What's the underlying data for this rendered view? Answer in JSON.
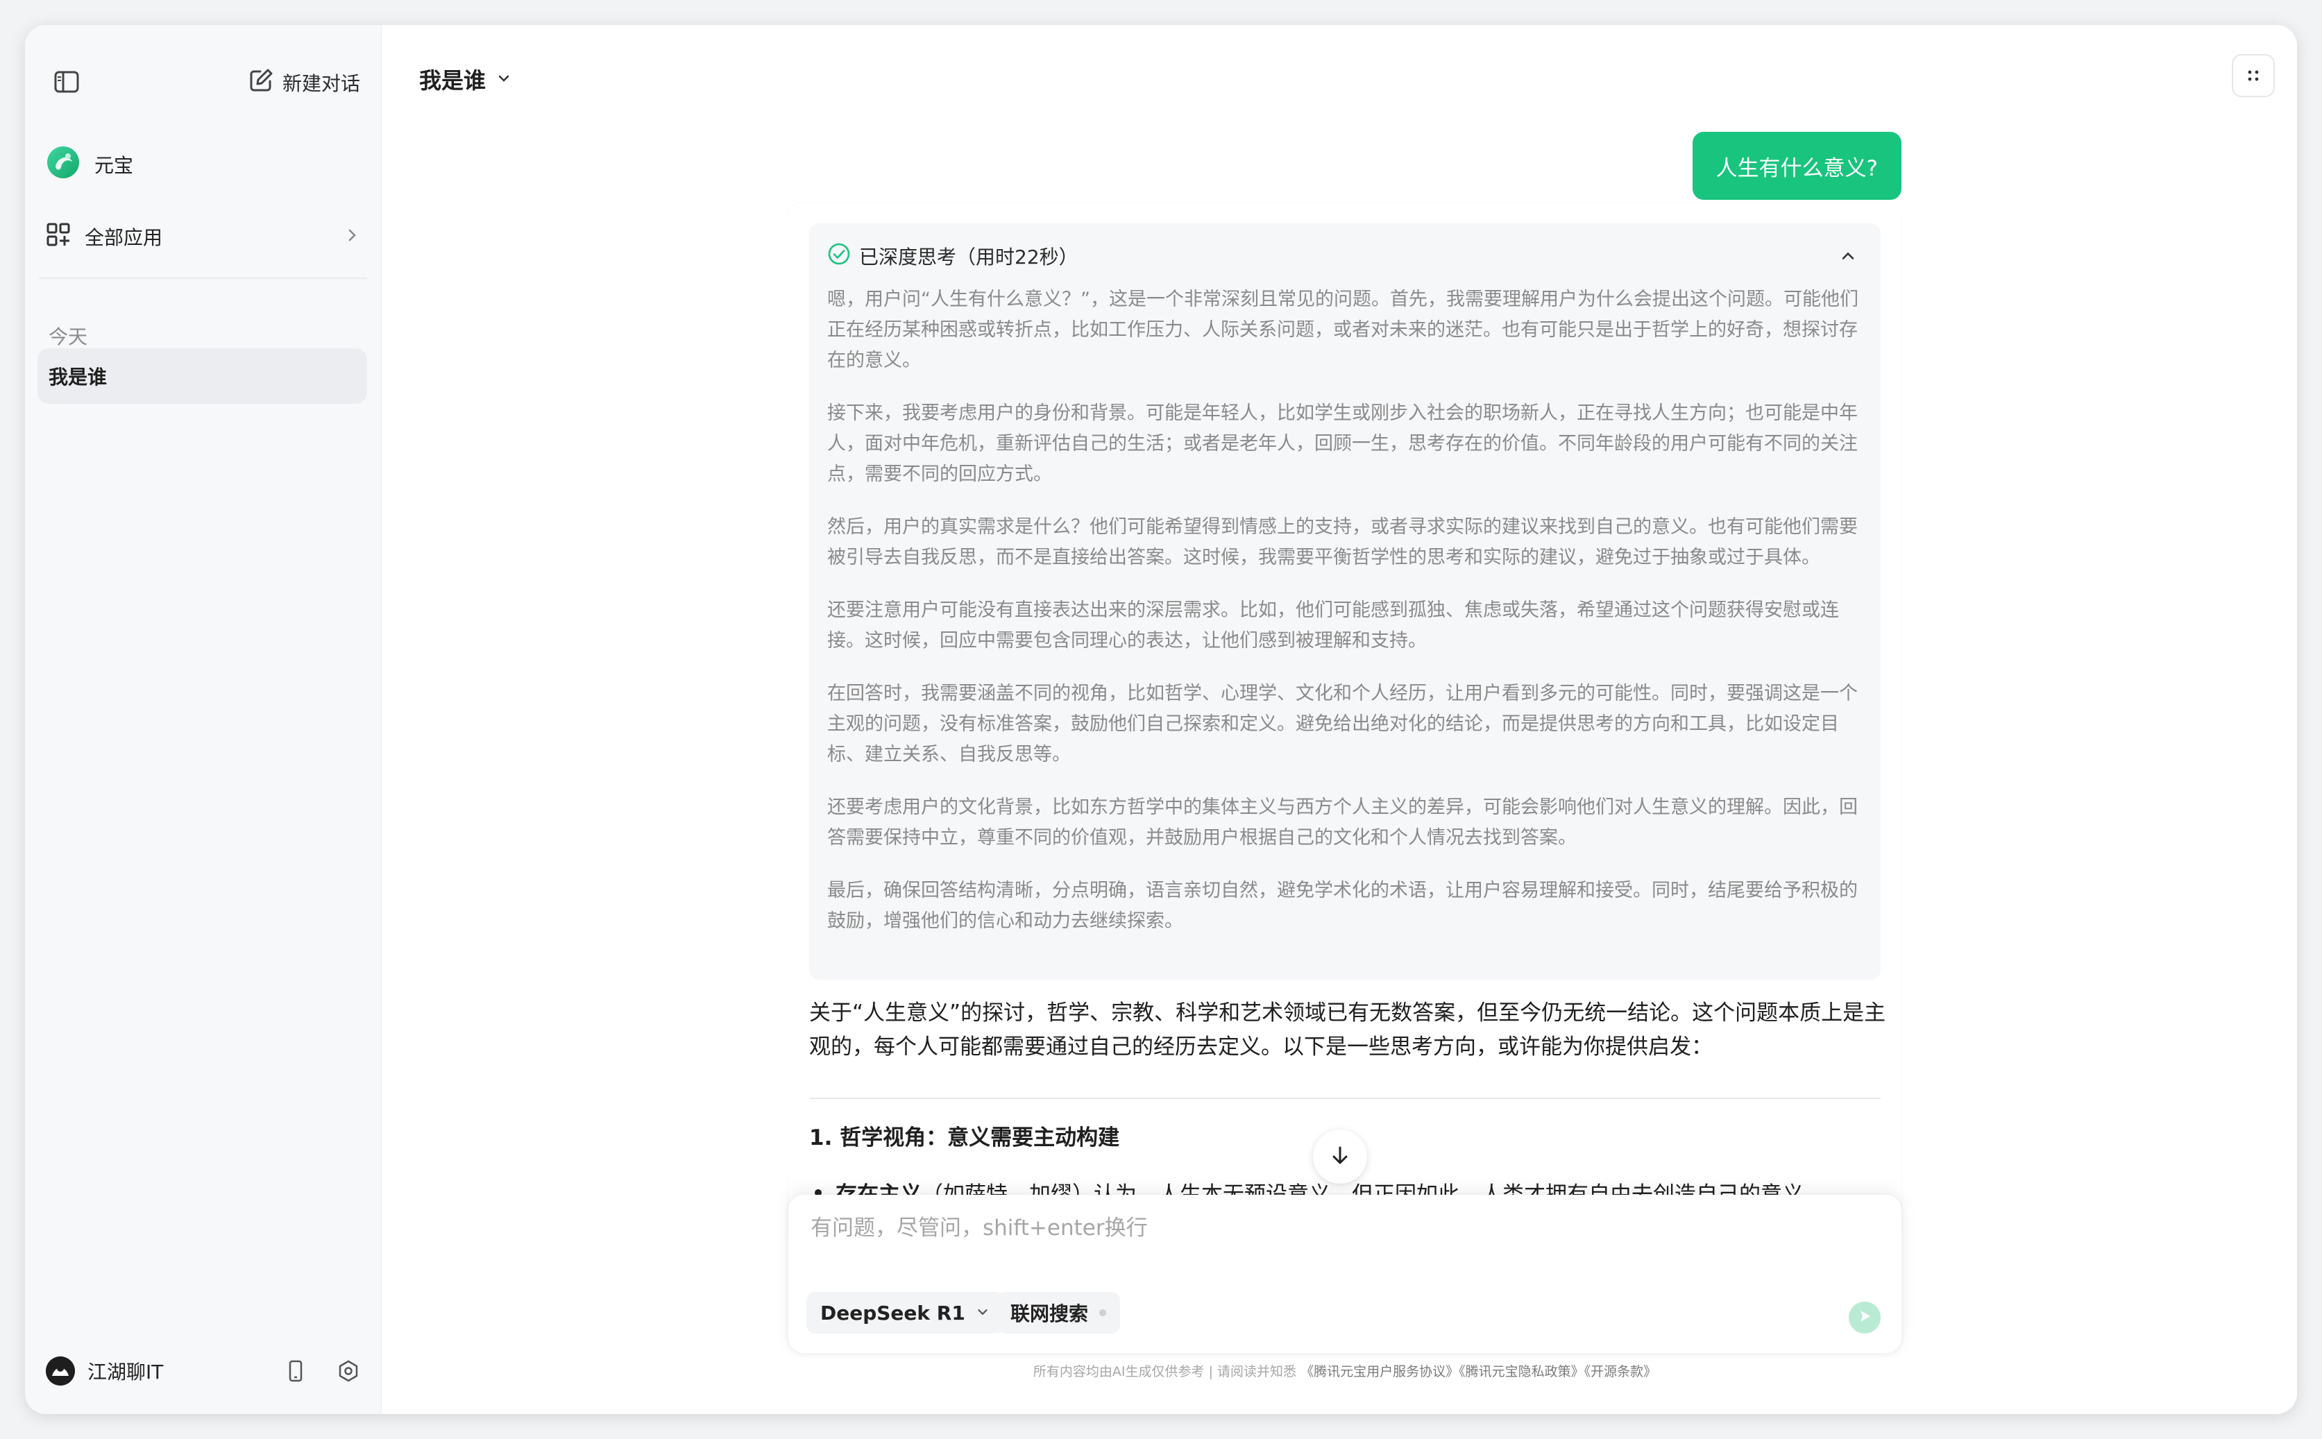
{
  "sidebar": {
    "new_chat_label": "新建对话",
    "yuanbao_label": "元宝",
    "all_apps_label": "全部应用",
    "section_today": "今天",
    "chats": [
      "我是谁"
    ],
    "user_name": "江湖聊IT"
  },
  "header": {
    "title": "我是谁"
  },
  "conversation": {
    "user_message": "人生有什么意义?",
    "thinking": {
      "status": "已深度思考（用时22秒）",
      "paragraphs": [
        "嗯，用户问“人生有什么意义？”，这是一个非常深刻且常见的问题。首先，我需要理解用户为什么会提出这个问题。可能他们正在经历某种困惑或转折点，比如工作压力、人际关系问题，或者对未来的迷茫。也有可能只是出于哲学上的好奇，想探讨存在的意义。",
        "接下来，我要考虑用户的身份和背景。可能是年轻人，比如学生或刚步入社会的职场新人，正在寻找人生方向；也可能是中年人，面对中年危机，重新评估自己的生活；或者是老年人，回顾一生，思考存在的价值。不同年龄段的用户可能有不同的关注点，需要不同的回应方式。",
        "然后，用户的真实需求是什么？他们可能希望得到情感上的支持，或者寻求实际的建议来找到自己的意义。也有可能他们需要被引导去自我反思，而不是直接给出答案。这时候，我需要平衡哲学性的思考和实际的建议，避免过于抽象或过于具体。",
        "还要注意用户可能没有直接表达出来的深层需求。比如，他们可能感到孤独、焦虑或失落，希望通过这个问题获得安慰或连接。这时候，回应中需要包含同理心的表达，让他们感到被理解和支持。",
        "在回答时，我需要涵盖不同的视角，比如哲学、心理学、文化和个人经历，让用户看到多元的可能性。同时，要强调这是一个主观的问题，没有标准答案，鼓励他们自己探索和定义。避免给出绝对化的结论，而是提供思考的方向和工具，比如设定目标、建立关系、自我反思等。",
        "还要考虑用户的文化背景，比如东方哲学中的集体主义与西方个人主义的差异，可能会影响他们对人生意义的理解。因此，回答需要保持中立，尊重不同的价值观，并鼓励用户根据自己的文化和个人情况去找到答案。",
        "最后，确保回答结构清晰，分点明确，语言亲切自然，避免学术化的术语，让用户容易理解和接受。同时，结尾要给予积极的鼓励，增强他们的信心和动力去继续探索。"
      ]
    },
    "answer_intro": "关于“人生意义”的探讨，哲学、宗教、科学和艺术领域已有无数答案，但至今仍无统一结论。这个问题本质上是主观的，每个人可能都需要通过自己的经历去定义。以下是一些思考方向，或许能为你提供启发：",
    "section_heading": "1. 哲学视角：意义需要主动构建",
    "bullet_bold": "存在主义",
    "bullet_rest": "（如萨特、加缪）认为，人生本无预设意义，但正因如此，人类才拥有自由去创造自己的意义。"
  },
  "composer": {
    "placeholder": "有问题，尽管问，shift+enter换行",
    "model_label": "DeepSeek R1",
    "search_label": "联网搜索"
  },
  "footer": {
    "note": "所有内容均由AI生成仅供参考 | 请阅读并知悉",
    "links": "《腾讯元宝用户服务协议》《腾讯元宝隐私政策》《开源条款》"
  },
  "colors": {
    "accent": "#18c47e",
    "sidebar_bg": "#f7f8fa",
    "thinking_text": "#8a8a8a"
  },
  "icons": [
    "sidebar-toggle-icon",
    "edit-icon",
    "yuanbao-logo-icon",
    "apps-grid-icon",
    "chevron-right-icon",
    "chevron-down-icon",
    "phone-icon",
    "settings-icon",
    "check-circle-icon",
    "chevron-up-icon",
    "arrow-down-icon",
    "send-icon",
    "more-grid-icon"
  ]
}
